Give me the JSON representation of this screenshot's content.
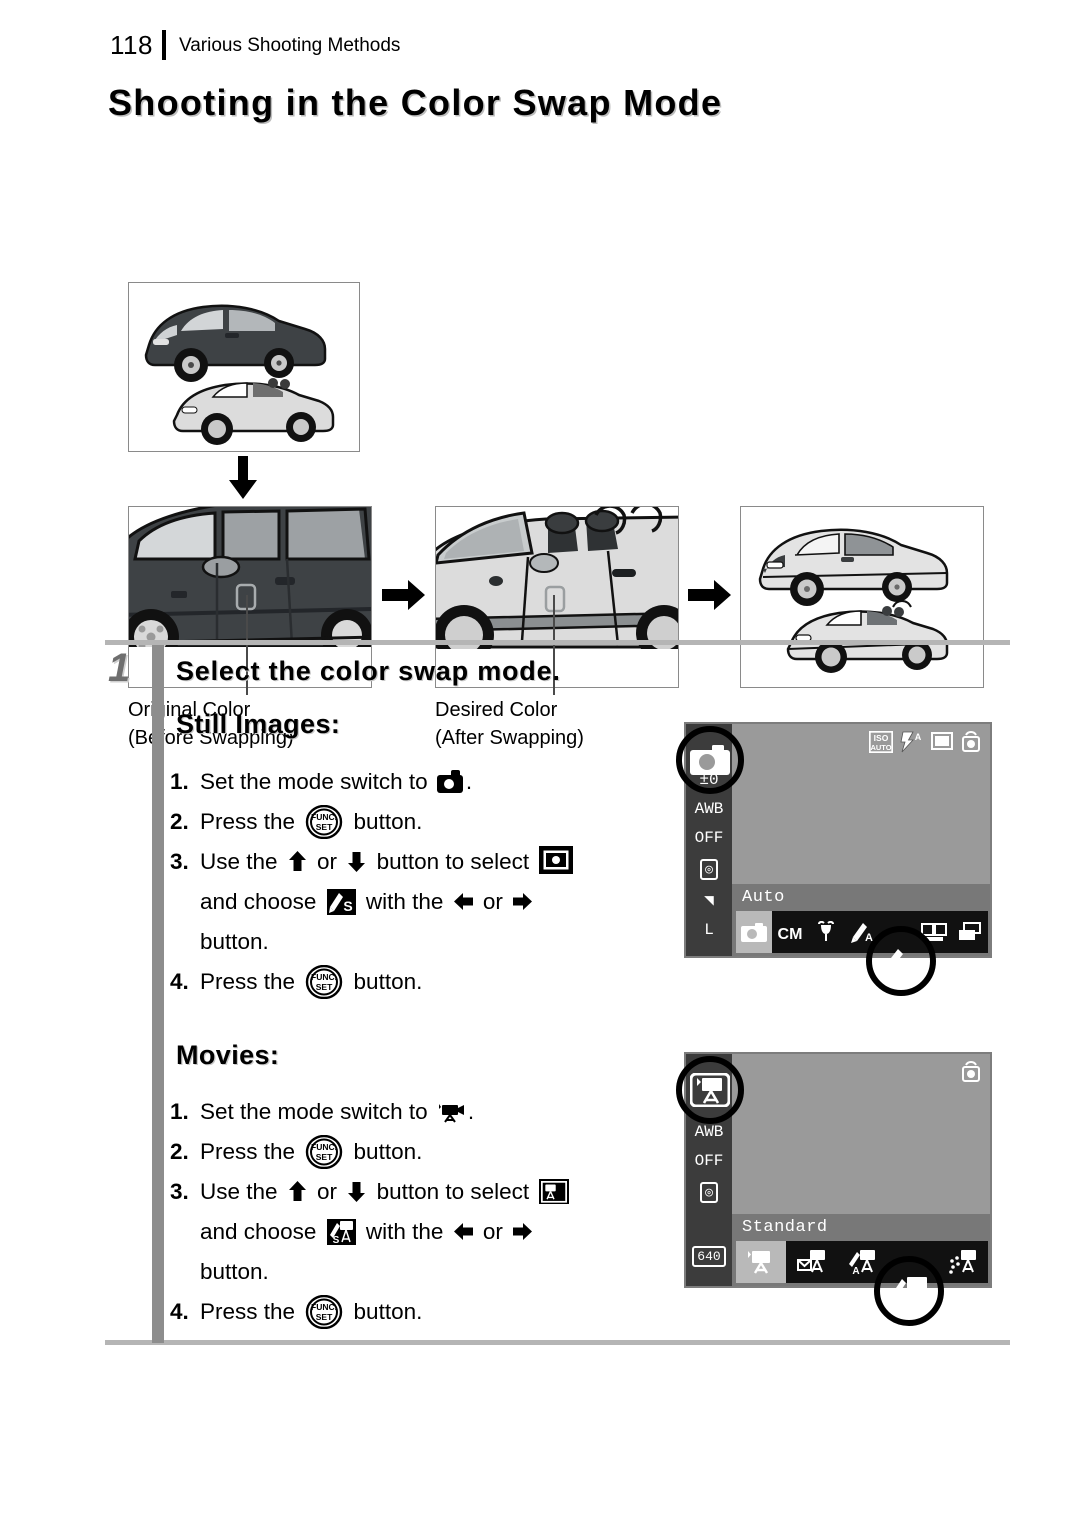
{
  "header": {
    "page_number": "118",
    "running_title": "Various Shooting Methods"
  },
  "title": "Shooting in the Color Swap Mode",
  "figure": {
    "panels": [
      {
        "name": "source-photo",
        "description": "Dark sedan above, light convertible below"
      },
      {
        "name": "original-color-closeup",
        "description": "Close-up of dark car door with color patch"
      },
      {
        "name": "desired-color-closeup",
        "description": "Close-up of light convertible door with color patch"
      },
      {
        "name": "result-photo",
        "description": "Both cars rendered in light color"
      }
    ],
    "captions": [
      "Original Color\n(Before Swapping)",
      "Desired Color\n(After Swapping)"
    ]
  },
  "step": {
    "number": "1",
    "heading": "Select the color swap mode.",
    "still": {
      "subheading": "Still Images:",
      "items": [
        {
          "marker": "1.",
          "pre": "Set the mode switch to ",
          "icons": [
            "camera-icon"
          ],
          "post": "."
        },
        {
          "marker": "2.",
          "pre": "Press the ",
          "icons": [
            "func-set-icon"
          ],
          "post": " button."
        },
        {
          "marker": "3.",
          "pre": "Use the ",
          "icons": [
            "up-arrow-icon",
            "down-arrow-icon",
            "my-colors-still-icon",
            "color-swap-icon",
            "left-arrow-icon",
            "right-arrow-icon"
          ],
          "post": " button."
        },
        {
          "marker": "4.",
          "pre": "Press the ",
          "icons": [
            "func-set-icon"
          ],
          "post": " button."
        }
      ],
      "line3_a": "Use the ",
      "line3_b": " or ",
      "line3_c": " button to select ",
      "line4_a": "and choose ",
      "line4_b": " with the ",
      "line4_c": " or ",
      "line5": "button."
    },
    "movies": {
      "subheading": "Movies:",
      "line1": "Set the mode switch to ",
      "line1_end": ".",
      "line2_a": "Press the ",
      "line2_b": " button.",
      "line3_a": "Use the ",
      "line3_b": " or ",
      "line3_c": " button to select ",
      "line4_a": "and choose ",
      "line4_b": " with the ",
      "line4_c": " or ",
      "line5": "button.",
      "markers": [
        "1.",
        "2.",
        "3.",
        "4."
      ]
    }
  },
  "lcd_still": {
    "sidebar_items": [
      "±0",
      "AWB",
      "OFF",
      "◎",
      "◥",
      "L"
    ],
    "top_icons": [
      "ISO AUTO",
      "flash-auto",
      "single-shot",
      "shake-warning"
    ],
    "mode_label": "Auto",
    "menu_items": [
      "camera-auto",
      "CM",
      "digital-macro",
      "color-accent",
      "color-swap",
      "stitch-assist",
      "poster-effect"
    ],
    "selected_menu_index": 4,
    "highlighted_mode": "camera-icon"
  },
  "lcd_movie": {
    "sidebar_items": [
      "AWB",
      "OFF",
      "◎",
      "640"
    ],
    "top_icons": [
      "shake-warning"
    ],
    "mode_label": "Standard",
    "menu_items": [
      "movie-standard",
      "movie-compact",
      "color-accent-movie",
      "color-swap-movie",
      "movie-effect"
    ],
    "selected_menu_index": 3,
    "highlighted_mode": "movie-icon"
  },
  "colors": {
    "rule_gray": "#b5b5b5",
    "step_bar_gray": "#8d8d8d",
    "lcd_bg": "#9a9a9a",
    "lcd_sidebar": "#3c3c3c",
    "lcd_menu_bg": "#787878",
    "car_dark": "#3e4245",
    "car_light": "#dcdcdc"
  }
}
